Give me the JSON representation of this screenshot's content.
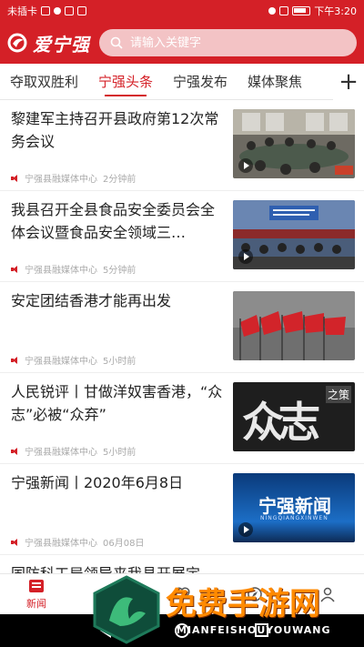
{
  "status_bar": {
    "left_text": "未插卡",
    "right_time": "下午3:20"
  },
  "header": {
    "app_name": "爱宁强",
    "search_placeholder": "请输入关键字"
  },
  "tabs": [
    {
      "label": "夺取双胜利",
      "active": false
    },
    {
      "label": "宁强头条",
      "active": true
    },
    {
      "label": "宁强发布",
      "active": false
    },
    {
      "label": "媒体聚焦",
      "active": false
    }
  ],
  "tab_add_label": "+",
  "news": [
    {
      "title": "黎建军主持召开县政府第12次常务会议",
      "source": "宁强县融媒体中心",
      "time": "2分钟前",
      "thumb": "meeting"
    },
    {
      "title": "我县召开全县食品安全委员会全体会议暨食品安全领域三…",
      "source": "宁强县融媒体中心",
      "time": "5分钟前",
      "thumb": "conference"
    },
    {
      "title": "安定团结香港才能再出发",
      "source": "宁强县融媒体中心",
      "time": "5小时前",
      "thumb": "flags"
    },
    {
      "title": "人民锐评丨甘做洋奴害香港，“众志”必被“众弃”",
      "source": "宁强县融媒体中心",
      "time": "5小时前",
      "thumb": "calligraphy"
    },
    {
      "title": "宁强新闻丨2020年6月8日",
      "source": "宁强县融媒体中心",
      "time": "06月08日",
      "thumb": "newslogo"
    }
  ],
  "partial_item_title": "国防科工局领导来我县开展定",
  "thumb_text": {
    "newslogo_main": "宁强新闻",
    "newslogo_sub": "NINGQIANGXINWEN",
    "calligraphy_big": "众志",
    "calligraphy_corner": "之策"
  },
  "bottom_nav": [
    {
      "label": "新闻",
      "icon": "news-icon",
      "active": true
    },
    {
      "label": "",
      "icon": "play-icon",
      "active": false
    },
    {
      "label": "",
      "icon": "heart-icon",
      "active": false
    },
    {
      "label": "",
      "icon": "compass-icon",
      "active": false
    },
    {
      "label": "",
      "icon": "user-icon",
      "active": false
    }
  ],
  "watermark": {
    "title": "免费手游网",
    "subtitle": "MIANFEISHOUYOUWANG"
  },
  "colors": {
    "brand_red": "#d42027",
    "text_dark": "#222222",
    "meta_gray": "#aaaaaa"
  }
}
